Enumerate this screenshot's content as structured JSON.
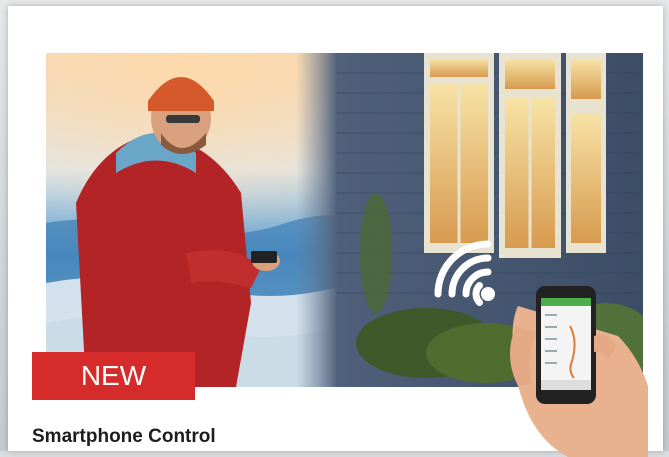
{
  "badge": {
    "text": "NEW",
    "color": "#d52b2b"
  },
  "caption": {
    "text": "Smartphone Control"
  },
  "photo": {
    "description_icons": [
      "man-with-phone",
      "house-windows",
      "wifi-icon",
      "hand-holding-smartphone"
    ]
  }
}
